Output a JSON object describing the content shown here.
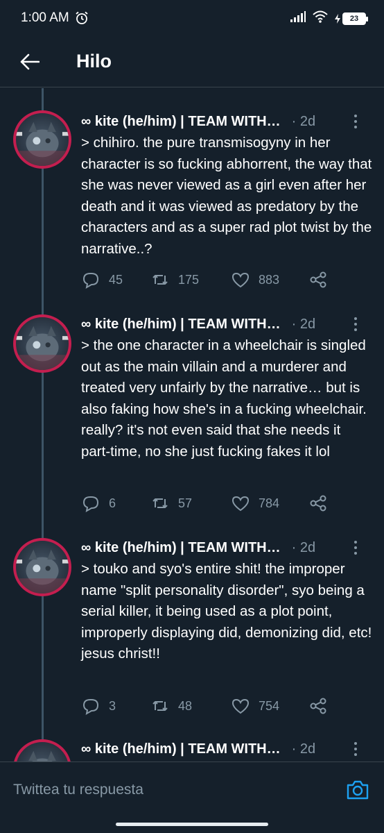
{
  "status": {
    "time": "1:00 AM",
    "battery": "23"
  },
  "header": {
    "title": "Hilo"
  },
  "tweets": [
    {
      "name": "∞ kite (he/him) | TEAM WITH…",
      "time": "· 2d",
      "text": "> chihiro. the pure transmisogyny in her character is so fucking abhorrent, the way that she was never viewed as a girl even after her death and it was viewed as predatory by the characters and as a super rad plot twist by the narrative..?",
      "replies": "45",
      "retweets": "175",
      "likes": "883"
    },
    {
      "name": "∞ kite (he/him) | TEAM WITH…",
      "time": "· 2d",
      "text": "> the one character in a wheelchair is singled out as the main villain and a murderer and treated very unfairly by the narrative… but is also faking how she's in a fucking wheelchair. really? it's not even said that she needs it part-time, no she just fucking fakes it lol",
      "replies": "6",
      "retweets": "57",
      "likes": "784"
    },
    {
      "name": "∞ kite (he/him) | TEAM WITH…",
      "time": "· 2d",
      "text": "> touko and syo's entire shit! the improper name \"split personality disorder\", syo being a serial killer, it being used as a plot point, improperly displaying did, demonizing did, etc! jesus christ!!",
      "replies": "3",
      "retweets": "48",
      "likes": "754"
    },
    {
      "name": "∞ kite (he/him) | TEAM WITH…",
      "time": "· 2d"
    }
  ],
  "reply": {
    "placeholder": "Twittea tu respuesta"
  },
  "colors": {
    "background": "#15202b",
    "muted": "#8899a6",
    "accent": "#1da1f2",
    "divider": "#38444d"
  }
}
